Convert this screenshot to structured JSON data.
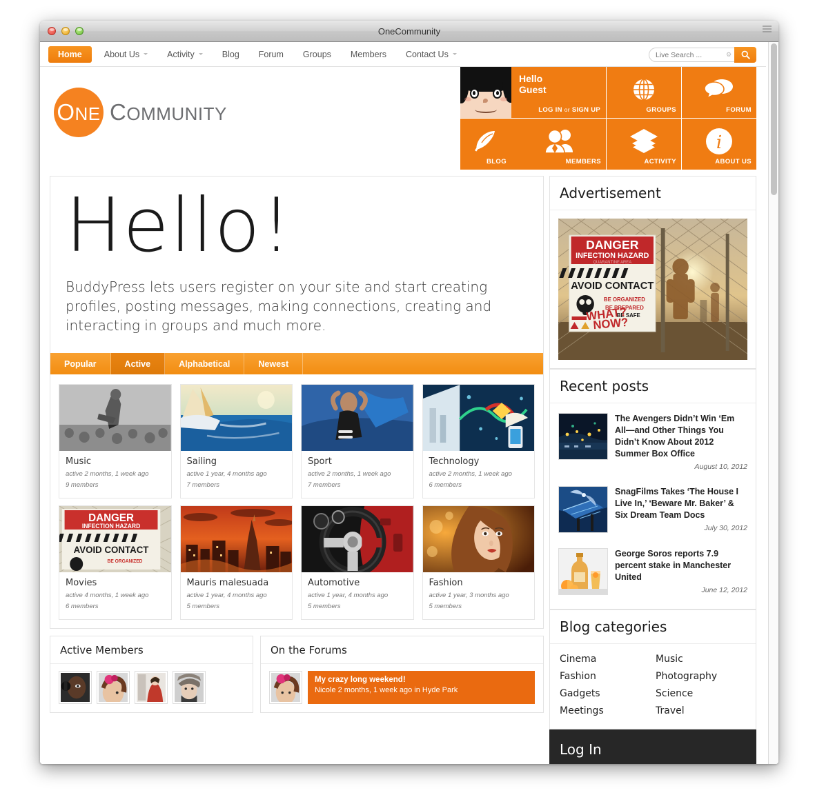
{
  "window": {
    "title": "OneCommunity"
  },
  "nav": {
    "items": [
      {
        "label": "Home",
        "active": true,
        "caret": false
      },
      {
        "label": "About Us",
        "active": false,
        "caret": true
      },
      {
        "label": "Activity",
        "active": false,
        "caret": true
      },
      {
        "label": "Blog",
        "active": false,
        "caret": false
      },
      {
        "label": "Forum",
        "active": false,
        "caret": false
      },
      {
        "label": "Groups",
        "active": false,
        "caret": false
      },
      {
        "label": "Members",
        "active": false,
        "caret": false
      },
      {
        "label": "Contact Us",
        "active": false,
        "caret": true
      }
    ],
    "search": {
      "placeholder": "Live Search ...",
      "value": "",
      "gear_icon": "gear-icon",
      "button_icon": "search-icon"
    }
  },
  "logo": {
    "one": "One",
    "community": "Community",
    "circle_color": "#f58220",
    "text_color": "#6d6e71"
  },
  "tiles": {
    "greeting_line1": "Hello",
    "greeting_line2": "Guest",
    "login": "LOG IN",
    "or": "or",
    "signup": "SIGN UP",
    "items": [
      {
        "label": "GROUPS",
        "icon": "globe-icon"
      },
      {
        "label": "FORUM",
        "icon": "speech-bubbles-icon"
      },
      {
        "label": "BLOG",
        "icon": "feather-icon"
      },
      {
        "label": "MEMBERS",
        "icon": "people-icon"
      },
      {
        "label": "ACTIVITY",
        "icon": "layers-icon"
      },
      {
        "label": "ABOUT US",
        "icon": "info-icon"
      }
    ],
    "color": "#f07c12"
  },
  "hero": {
    "heading": "Hello!",
    "paragraph": "BuddyPress lets users register on your site and start creating profiles, posting messages, making connections, creating and interacting in groups and much more."
  },
  "tabs": [
    {
      "label": "Popular",
      "active": false
    },
    {
      "label": "Active",
      "active": true
    },
    {
      "label": "Alphabetical",
      "active": false
    },
    {
      "label": "Newest",
      "active": false
    }
  ],
  "groups": [
    {
      "title": "Music",
      "activity": "active 2 months, 1 week ago",
      "members": "9 members",
      "image": "concert-bw"
    },
    {
      "title": "Sailing",
      "activity": "active 1 year, 4 months ago",
      "members": "7 members",
      "image": "sailing-boat"
    },
    {
      "title": "Sport",
      "activity": "active 2 months, 1 week ago",
      "members": "7 members",
      "image": "sport-athlete"
    },
    {
      "title": "Technology",
      "activity": "active 2 months, 1 week ago",
      "members": "6 members",
      "image": "technology-collage"
    },
    {
      "title": "Movies",
      "activity": "active 4 months, 1 week ago",
      "members": "6 members",
      "image": "danger-sign"
    },
    {
      "title": "Mauris malesuada",
      "activity": "active 1 year, 4 months ago",
      "members": "5 members",
      "image": "city-sunset"
    },
    {
      "title": "Automotive",
      "activity": "active 1 year, 4 months ago",
      "members": "5 members",
      "image": "steering-wheel"
    },
    {
      "title": "Fashion",
      "activity": "active 1 year, 3 months ago",
      "members": "5 members",
      "image": "fashion-model"
    }
  ],
  "active_members": {
    "heading": "Active Members",
    "avatars": [
      "member-1",
      "member-2",
      "member-3",
      "member-4"
    ]
  },
  "forums": {
    "heading": "On the Forums",
    "post": {
      "avatar": "nicole-avatar",
      "title": "My crazy long weekend!",
      "meta": "Nicole 2 months, 1 week ago in Hyde Park"
    }
  },
  "sidebar": {
    "advertisement": {
      "heading": "Advertisement",
      "image": "danger-infection-hazard-banner"
    },
    "recent_posts": {
      "heading": "Recent posts",
      "items": [
        {
          "title": "The Avengers Didn’t Win ‘Em All—and Other Things You Didn’t Know About 2012 Summer Box Office",
          "date": "August 10, 2012",
          "thumb": "night-lights"
        },
        {
          "title": "SnagFilms Takes ‘The House I Live In,’ ‘Beware Mr. Baker’ & Six Dream Team Docs",
          "date": "July 30, 2012",
          "thumb": "solar-panels"
        },
        {
          "title": "George Soros reports 7.9 percent stake in Manchester United",
          "date": "June 12, 2012",
          "thumb": "bottle-orange"
        }
      ]
    },
    "blog_categories": {
      "heading": "Blog categories",
      "items": [
        "Cinema",
        "Music",
        "Fashion",
        "Photography",
        "Gadgets",
        "Science",
        "Meetings",
        "Travel"
      ]
    },
    "login": {
      "heading": "Log In"
    }
  }
}
